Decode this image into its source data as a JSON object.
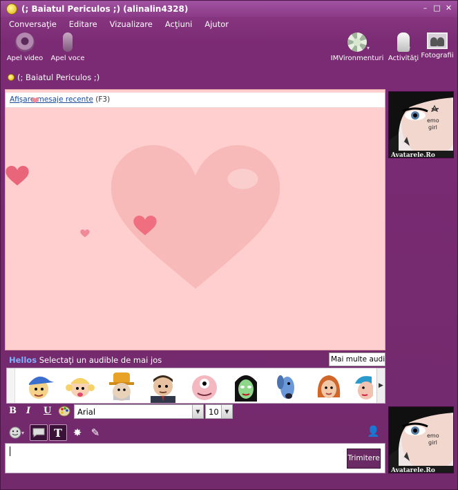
{
  "window": {
    "title": "(; Baiatul Periculos ;) (alinalin4328)",
    "controls": [
      "–",
      "□",
      "✕"
    ]
  },
  "menu": [
    "Conversaţie",
    "Editare",
    "Vizualizare",
    "Acţiuni",
    "Ajutor"
  ],
  "toolbar": {
    "video": "Apel video",
    "voice": "Apel voce",
    "environments": "IMVironmenturi",
    "activities": "Activităţi",
    "photos": "Fotografii"
  },
  "buddy": {
    "name": "(; Baiatul Periculos ;)",
    "status_color": "#e8b800"
  },
  "chat": {
    "recent_link": "Afişare mesaje recente",
    "recent_shortcut": "(F3)",
    "background": "#ffcfcf"
  },
  "audibles": {
    "brand": "Hellos",
    "prompt": "Selectaţi un audible de mai jos",
    "more": "Mai multe audible-uri",
    "faces": [
      "boy-cap-face-icon",
      "girl-pigtails-face-icon",
      "old-man-hat-face-icon",
      "businessman-face-icon",
      "cyclops-face-icon",
      "witch-face-icon",
      "dog-face-icon",
      "woman-face-icon",
      "partial-face-icon"
    ]
  },
  "format": {
    "bold": "B",
    "italic": "I",
    "underline": "U",
    "font": "Arial",
    "size": "10"
  },
  "avatar": {
    "caption": "Avatarele.Ro",
    "text": "emo girl"
  },
  "send": "Trimitere"
}
